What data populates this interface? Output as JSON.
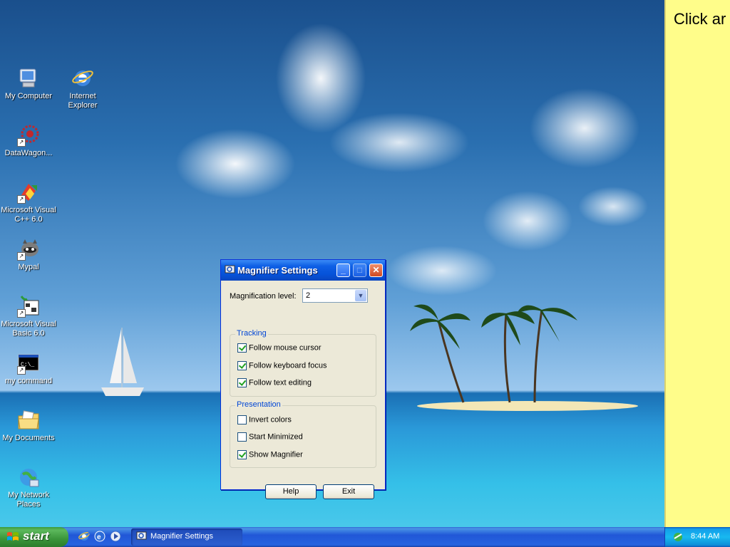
{
  "desktop": {
    "icons": [
      {
        "label": "My Computer",
        "icon": "computer-icon"
      },
      {
        "label": "Internet Explorer",
        "icon": "internet-explorer-icon"
      },
      {
        "label": "DataWagon...",
        "icon": "datawagon-icon"
      },
      {
        "label": "Microsoft Visual C++ 6.0",
        "icon": "visual-cpp-icon"
      },
      {
        "label": "Mypal",
        "icon": "mypal-icon"
      },
      {
        "label": "Microsoft Visual Basic 6.0",
        "icon": "visual-basic-icon"
      },
      {
        "label": "my command",
        "icon": "command-prompt-icon"
      },
      {
        "label": "My Documents",
        "icon": "folder-icon"
      },
      {
        "label": "My Network Places",
        "icon": "network-places-icon"
      }
    ]
  },
  "yellow_panel": {
    "text": "Click ar"
  },
  "dialog": {
    "title": "Magnifier Settings",
    "magnification_label": "Magnification level:",
    "magnification_value": "2",
    "tracking": {
      "title": "Tracking",
      "options": [
        {
          "label": "Follow mouse cursor",
          "checked": true
        },
        {
          "label": "Follow keyboard focus",
          "checked": true
        },
        {
          "label": "Follow text editing",
          "checked": true
        }
      ]
    },
    "presentation": {
      "title": "Presentation",
      "options": [
        {
          "label": "Invert colors",
          "checked": false
        },
        {
          "label": "Start Minimized",
          "checked": false
        },
        {
          "label": "Show Magnifier",
          "checked": true
        }
      ]
    },
    "help_label": "Help",
    "exit_label": "Exit"
  },
  "taskbar": {
    "start_label": "start",
    "task_label": "Magnifier Settings",
    "clock": "8:44 AM"
  }
}
